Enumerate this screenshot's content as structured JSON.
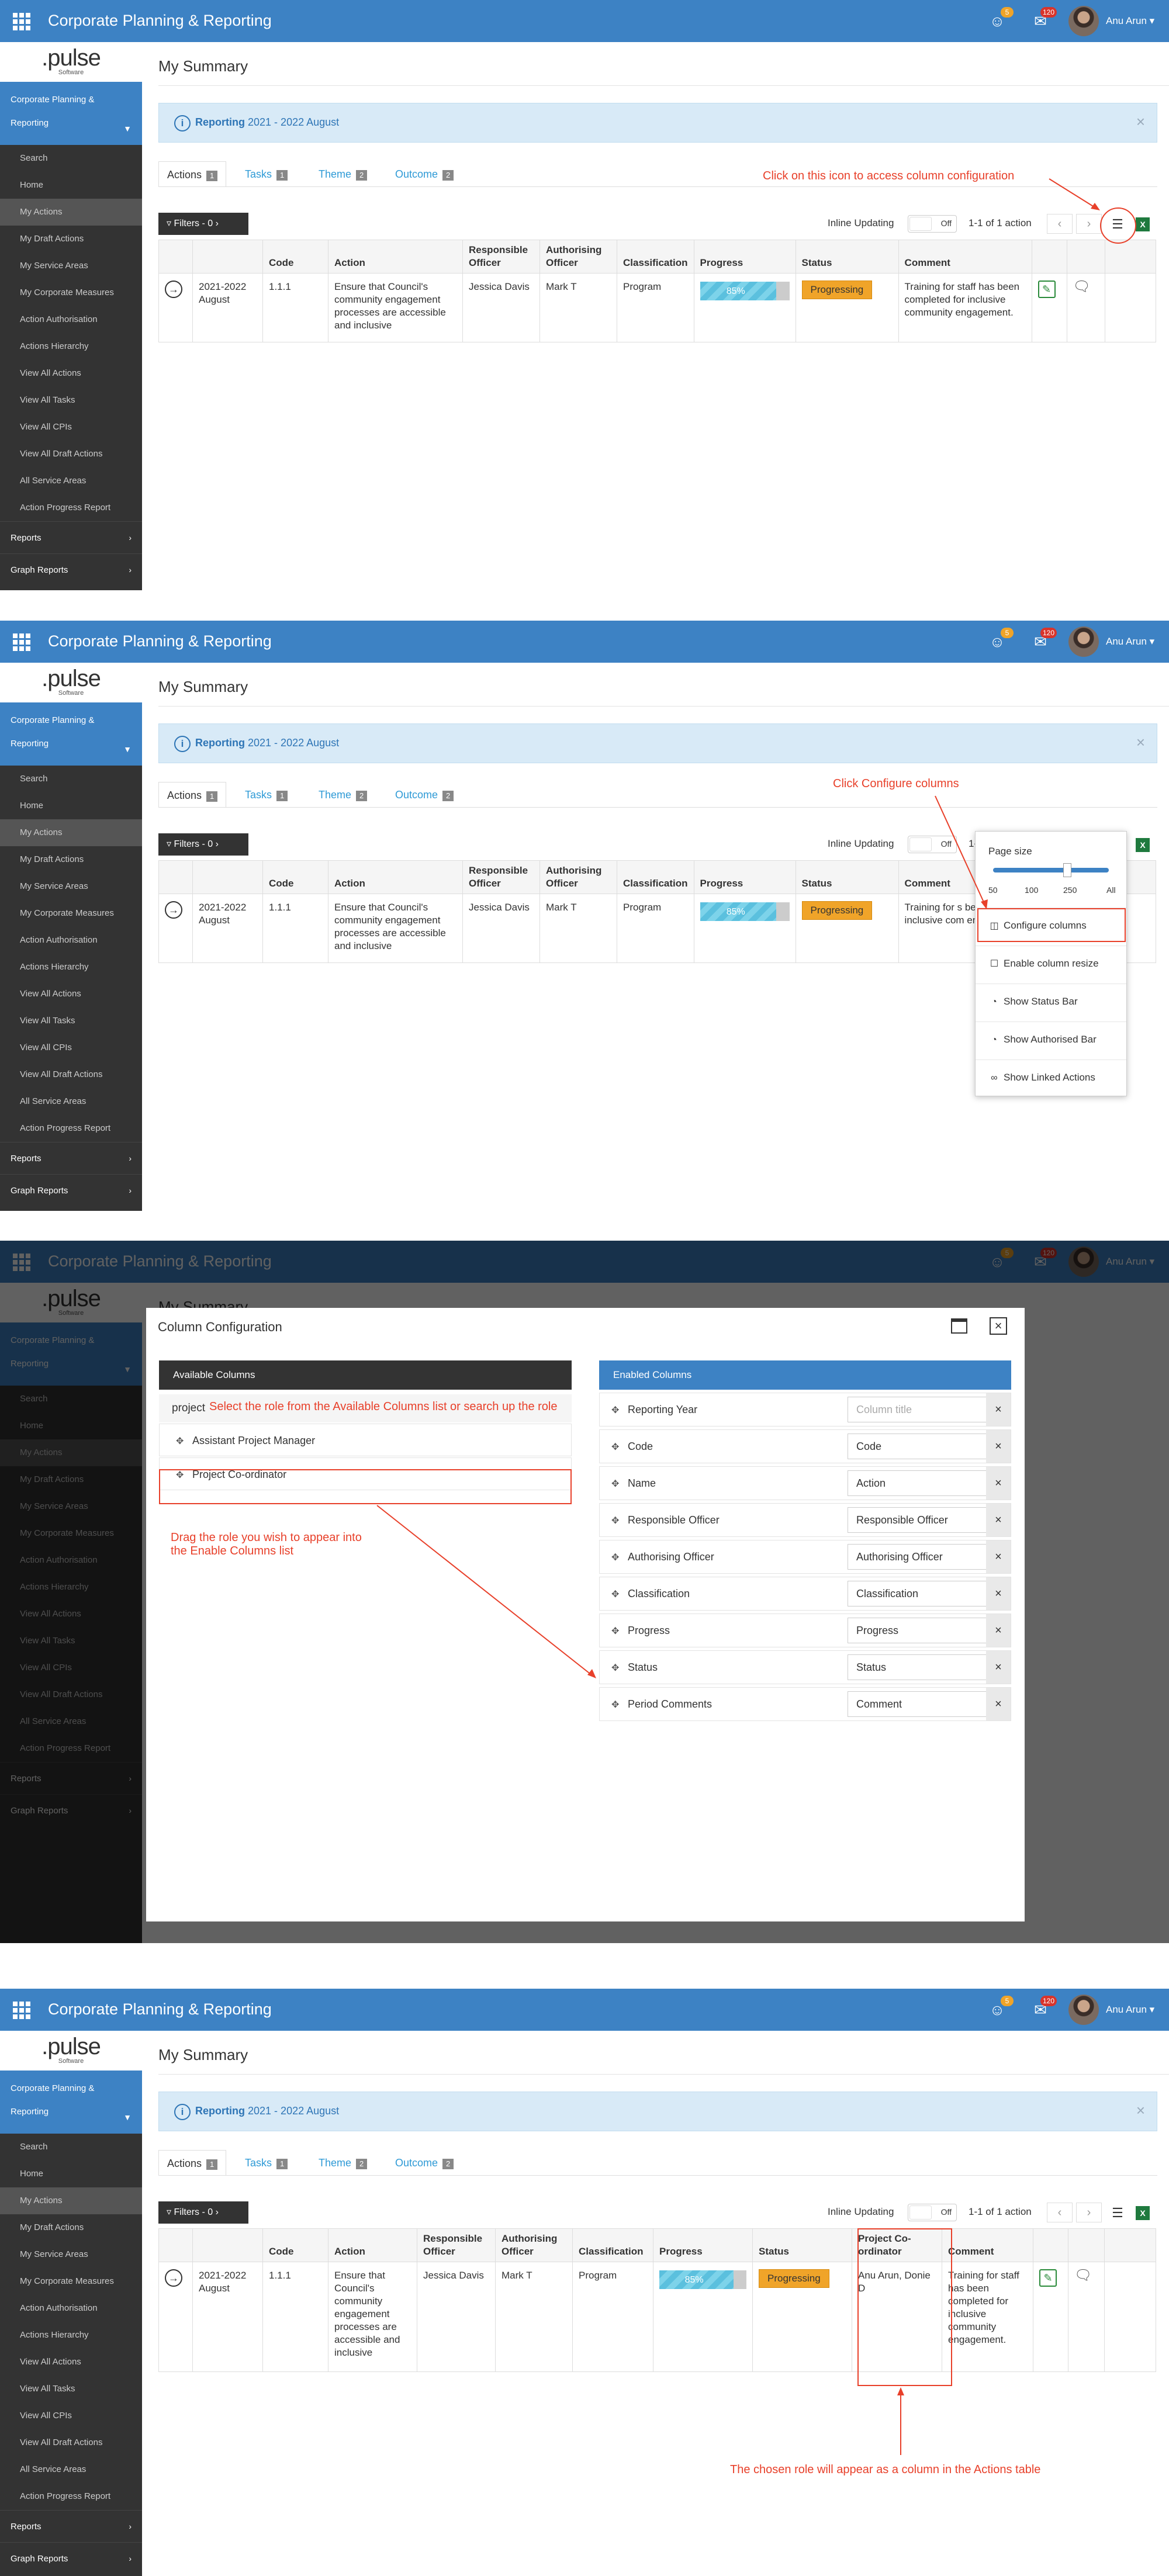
{
  "app": {
    "title": "Corporate Planning & Reporting",
    "user_name": "Anu Arun",
    "notification_count": "5",
    "mail_count": "120",
    "logo_text": ".pulse",
    "logo_sub": "Software"
  },
  "sidebar": {
    "group_label_1": "Corporate Planning &",
    "group_label_2": "Reporting",
    "items": [
      "Search",
      "Home",
      "My Actions",
      "My Draft Actions",
      "My Service Areas",
      "My Corporate Measures",
      "Action Authorisation",
      "Actions Hierarchy",
      "View All Actions",
      "View All Tasks",
      "View All CPIs",
      "View All Draft Actions",
      "All Service Areas",
      "Action Progress Report"
    ],
    "sections": [
      "Reports",
      "Graph Reports"
    ]
  },
  "page": {
    "title": "My Summary",
    "alert_label": "Reporting",
    "alert_period": "2021 - 2022 August"
  },
  "tabs": [
    {
      "label": "Actions",
      "count": "1"
    },
    {
      "label": "Tasks",
      "count": "1"
    },
    {
      "label": "Theme",
      "count": "2"
    },
    {
      "label": "Outcome",
      "count": "2"
    }
  ],
  "toolbar": {
    "filters_label": "Filters - 0",
    "inline_updating_label": "Inline Updating",
    "toggle_off_label": "Off",
    "pager_text": "1-1 of 1 action",
    "pager_text_short": "1-"
  },
  "table": {
    "headers": [
      "Code",
      "Action",
      "Responsible Officer",
      "Authorising Officer",
      "Classification",
      "Progress",
      "Status",
      "Comment"
    ],
    "header_project": "Project Co-ordinator",
    "row": {
      "period": "2021-2022 August",
      "code": "1.1.1",
      "action": "Ensure that Council's community engagement processes are accessible and inclusive",
      "responsible": "Jessica Davis",
      "authorising": "Mark T",
      "classification": "Program",
      "progress": 85,
      "progress_label": "85%",
      "status": "Progressing",
      "comment": "Training for staff has been completed for inclusive community engagement.",
      "comment_partial": "Training for s been comple inclusive com engagement.",
      "project": "Anu Arun, Donie D"
    }
  },
  "popup": {
    "page_size_label": "Page size",
    "slider_labels": [
      "50",
      "100",
      "250",
      "All"
    ],
    "items": [
      "Configure columns",
      "Enable column resize",
      "Show Status Bar",
      "Show Authorised Bar",
      "Show Linked Actions"
    ]
  },
  "modal": {
    "title": "Column Configuration",
    "available_header": "Available Columns",
    "search_value": "project",
    "available_items": [
      "Assistant Project Manager",
      "Project Co-ordinator"
    ],
    "enabled_header": "Enabled Columns",
    "enabled_items": [
      {
        "name": "Reporting Year",
        "title": "",
        "placeholder": "Column title"
      },
      {
        "name": "Code",
        "title": "Code"
      },
      {
        "name": "Name",
        "title": "Action"
      },
      {
        "name": "Responsible Officer",
        "title": "Responsible Officer"
      },
      {
        "name": "Authorising Officer",
        "title": "Authorising Officer"
      },
      {
        "name": "Classification",
        "title": "Classification"
      },
      {
        "name": "Progress",
        "title": "Progress"
      },
      {
        "name": "Status",
        "title": "Status"
      },
      {
        "name": "Period Comments",
        "title": "Comment"
      }
    ]
  },
  "annotations": {
    "step1": "Click on this icon to access column configuration",
    "step2": "Click Configure columns",
    "step3_search": "Select the role from the Available Columns list or search up the role",
    "step3_drag_1": "Drag the role you wish to appear into",
    "step3_drag_2": "the Enable Columns list",
    "step4": "The chosen role will appear as a column in the Actions table"
  },
  "colors": {
    "brand_blue": "#3d82c4",
    "sidebar_dark": "#333333",
    "annotation_red": "#e8402a",
    "status_orange": "#f0a429",
    "progress_cyan": "#5bc0de"
  },
  "icons": [
    "apps-grid-icon",
    "bell-icon",
    "mail-icon",
    "info-icon",
    "filter-icon",
    "chevron-right-icon",
    "columns-config-icon",
    "excel-icon",
    "arrow-circle-right-icon",
    "edit-icon",
    "comment-icon",
    "drag-handle-icon",
    "close-icon",
    "maximize-icon"
  ]
}
